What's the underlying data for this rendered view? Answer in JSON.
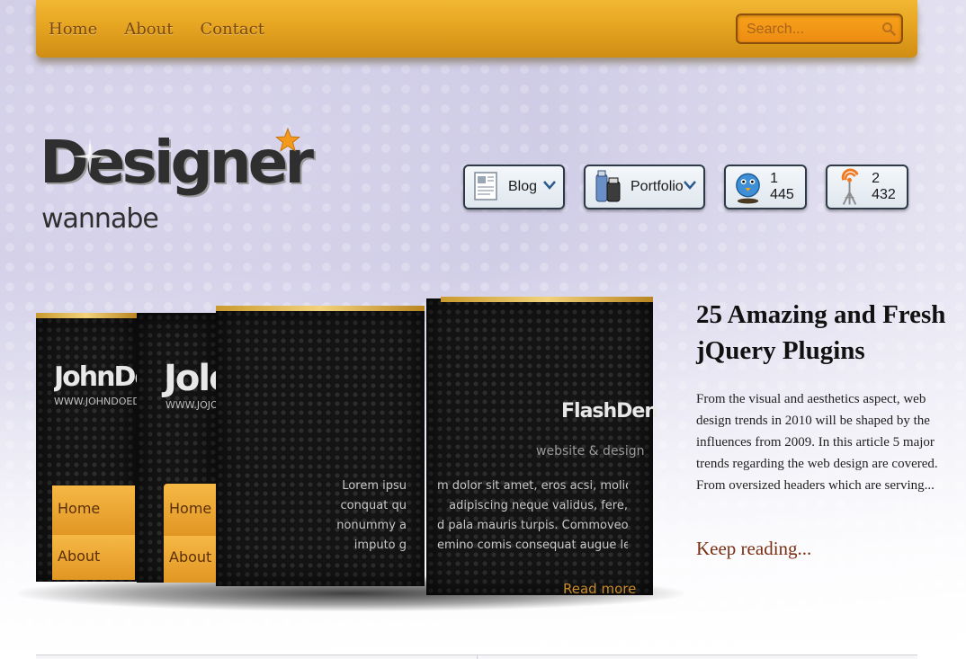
{
  "nav": {
    "items": [
      "Home",
      "About",
      "Contact"
    ]
  },
  "search": {
    "placeholder": "Search..."
  },
  "logo": {
    "title": "Designer",
    "subtitle": "wannabe"
  },
  "widgets": {
    "blog_label": "Blog",
    "portfolio_label": "Portfolio",
    "twitter_count": "1 445",
    "rss_count": "2 432"
  },
  "slider": {
    "panel1_brand": "JohnDo",
    "panel1_url": "WWW.JOHNDOEDESIG",
    "panel1_menu": [
      "Home",
      "About"
    ],
    "panel2_brand": "Jole",
    "panel2_url": "WWW.JOJOM",
    "panel2_menu": [
      "Home",
      "About"
    ],
    "panel3_text": [
      "Lorem ipsu",
      "conquat qu",
      "nonummy a",
      "imputo g"
    ],
    "panel4_brand": "FlashDen",
    "panel4_tagline": "website & design",
    "panel4_text": [
      "m dolor sit amet, eros acsi, molior",
      "adipiscing neque validus, fere,",
      "d pala mauris turpis. Commoveo",
      "emino comis consequat augue le"
    ],
    "panel4_more": "Read more"
  },
  "article": {
    "title": "25 Amazing and Fresh jQuery Plugins",
    "body": "From the visual and aesthetics aspect, web design trends in 2010 will be shaped by the influences from 2009. In this article 5 major trends regarding the web design are covered. From oversized headers which are serving...",
    "more": "Keep reading..."
  },
  "colors": {
    "accent_orange": "#e6a521",
    "nav_text": "#7a4a12",
    "link_brown": "#7b2f12",
    "background_lavender": "#cfcce6"
  },
  "icons": [
    "search-icon",
    "star-icon",
    "blog-icon",
    "portfolio-icon",
    "twitter-bird-icon",
    "rss-icon",
    "chevron-down-icon"
  ]
}
